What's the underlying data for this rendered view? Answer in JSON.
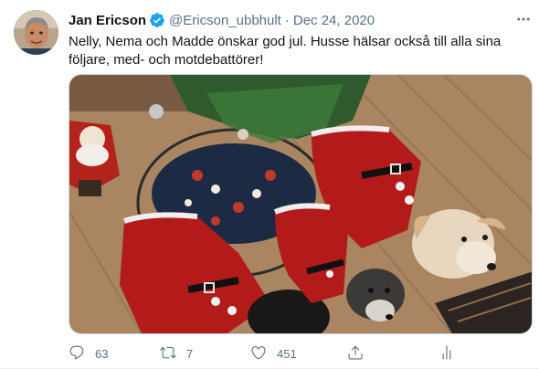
{
  "tweet": {
    "author_name": "Jan Ericson",
    "verified_icon": "verified-badge-icon",
    "handle": "@Ericson_ubbhult",
    "separator": "·",
    "date": "Dec 24, 2020",
    "text_line1": "Nelly, Nema och Madde önskar god jul. Husse hälsar också till alla sina",
    "text_line2": "följare, med- och motdebattörer!"
  },
  "actions": {
    "reply_count": "63",
    "retweet_count": "7",
    "like_count": "451"
  },
  "colors": {
    "accent": "#1da1f2",
    "muted": "#5b7083",
    "text": "#0f1419"
  }
}
